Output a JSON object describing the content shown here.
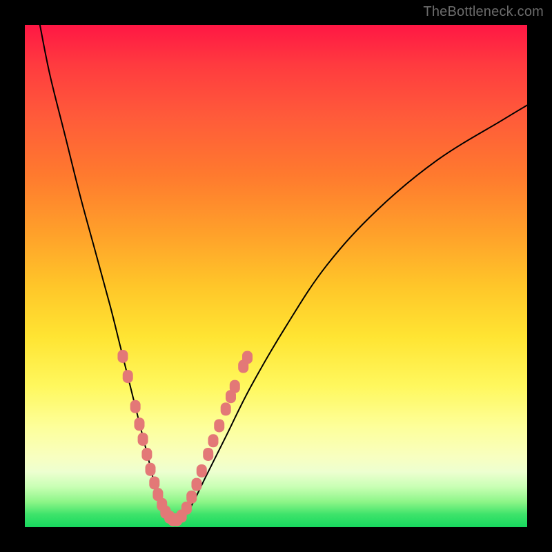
{
  "watermark": "TheBottleneck.com",
  "chart_data": {
    "type": "line",
    "title": "",
    "xlabel": "",
    "ylabel": "",
    "xlim": [
      0,
      100
    ],
    "ylim": [
      0,
      100
    ],
    "grid": false,
    "legend": false,
    "series": [
      {
        "name": "bottleneck-curve",
        "color": "#000000",
        "x": [
          3,
          5,
          8,
          11,
          14,
          17,
          19,
          21,
          23,
          24.5,
          26,
          27.5,
          29,
          31,
          33,
          36,
          40,
          45,
          52,
          60,
          70,
          82,
          95,
          100
        ],
        "y": [
          100,
          90,
          78,
          66,
          55,
          44,
          36,
          28,
          20,
          14,
          8,
          4,
          1.5,
          1.5,
          4,
          10,
          18,
          28,
          40,
          52,
          63,
          73,
          81,
          84
        ]
      }
    ],
    "markers": [
      {
        "name": "highlight-dots",
        "color": "#e37877",
        "shape": "rounded",
        "points": [
          {
            "x": 19.5,
            "y": 34
          },
          {
            "x": 20.5,
            "y": 30
          },
          {
            "x": 22.0,
            "y": 24
          },
          {
            "x": 22.8,
            "y": 20.5
          },
          {
            "x": 23.5,
            "y": 17.5
          },
          {
            "x": 24.3,
            "y": 14.5
          },
          {
            "x": 25.0,
            "y": 11.5
          },
          {
            "x": 25.8,
            "y": 8.8
          },
          {
            "x": 26.5,
            "y": 6.5
          },
          {
            "x": 27.3,
            "y": 4.5
          },
          {
            "x": 28.0,
            "y": 3.0
          },
          {
            "x": 28.8,
            "y": 2.0
          },
          {
            "x": 29.5,
            "y": 1.5
          },
          {
            "x": 30.3,
            "y": 1.5
          },
          {
            "x": 31.2,
            "y": 2.2
          },
          {
            "x": 32.2,
            "y": 3.8
          },
          {
            "x": 33.2,
            "y": 6.0
          },
          {
            "x": 34.2,
            "y": 8.5
          },
          {
            "x": 35.2,
            "y": 11.2
          },
          {
            "x": 36.5,
            "y": 14.5
          },
          {
            "x": 37.5,
            "y": 17.2
          },
          {
            "x": 38.7,
            "y": 20.2
          },
          {
            "x": 40.0,
            "y": 23.5
          },
          {
            "x": 41.0,
            "y": 26.0
          },
          {
            "x": 41.8,
            "y": 28.0
          },
          {
            "x": 43.5,
            "y": 32.0
          },
          {
            "x": 44.3,
            "y": 33.8
          }
        ]
      }
    ]
  }
}
